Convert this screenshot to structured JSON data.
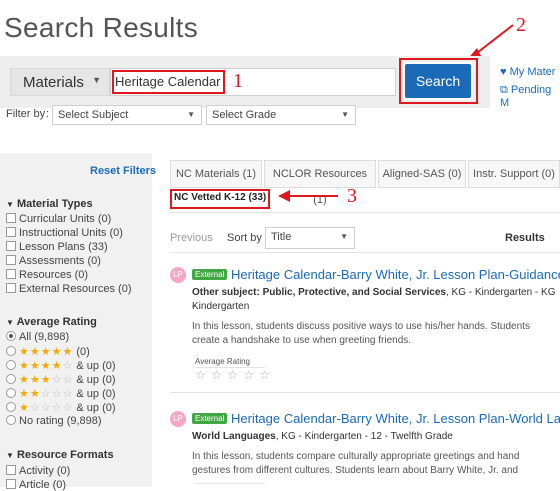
{
  "page": {
    "title": "Search Results"
  },
  "search": {
    "material_type": "Materials",
    "query": "Heritage Calendar",
    "button": "Search"
  },
  "right_links": [
    {
      "icon": "heart-icon",
      "label": "My Mater"
    },
    {
      "icon": "external-link-icon",
      "label": "Pending M"
    }
  ],
  "filter_bar": {
    "label": "Filter by",
    "subject_placeholder": "Select Subject",
    "grade_placeholder": "Select Grade"
  },
  "annotations": [
    "1",
    "2",
    "3"
  ],
  "sidebar": {
    "reset": "Reset Filters",
    "material_types": {
      "heading": "Material Types",
      "items": [
        "Curricular Units  (0)",
        "Instructional Units  (0)",
        "Lesson Plans  (33)",
        "Assessments  (0)",
        "Resources  (0)",
        "External Resources  (0)"
      ]
    },
    "average_rating": {
      "heading": "Average Rating",
      "all": "All  (9,898)",
      "rows": [
        {
          "stars": 5,
          "label": "(0)"
        },
        {
          "stars": 4,
          "label": "& up  (0)"
        },
        {
          "stars": 3,
          "label": "& up  (0)"
        },
        {
          "stars": 2,
          "label": "& up  (0)"
        },
        {
          "stars": 1,
          "label": "& up  (0)"
        }
      ],
      "no_rating": "No rating  (9,898)"
    },
    "resource_formats": {
      "heading": "Resource Formats",
      "items": [
        "Activity  (0)",
        "Article  (0)"
      ]
    }
  },
  "tabs": [
    "NC Materials (1)",
    "NCLOR Resources (1)",
    "Aligned-SAS (0)",
    "Instr. Support (0)"
  ],
  "sub_tab": "NC Vetted K-12 (33)",
  "sort": {
    "previous": "Previous",
    "label": "Sort by",
    "value": "Title",
    "results": "Results"
  },
  "results": [
    {
      "avatar": "LP",
      "badge": "External",
      "title": "Heritage Calendar-Barry White, Jr. Lesson Plan-Guidance ...",
      "subject_bold": "Other subject: Public, Protective, and Social Services",
      "subject_rest": ", KG - Kindergarten - KG -",
      "subject_line2": "Kindergarten",
      "desc1": "In this lesson, students discuss positive ways to use his/her hands. Students",
      "desc2": "create a handshake to use when greeting friends.",
      "rating_label": "Average Rating",
      "rating_stars": "☆ ☆ ☆ ☆ ☆"
    },
    {
      "avatar": "LP",
      "badge": "External",
      "title": "Heritage Calendar-Barry White, Jr. Lesson Plan-World Lan...",
      "subject_bold": "World Languages",
      "subject_rest": ", KG - Kindergarten - 12 - Twelfth Grade",
      "desc1": "In this lesson, students compare culturally appropriate greetings and hand",
      "desc2": "gestures from different cultures. Students learn about Barry White, Jr. and"
    }
  ],
  "colors": {
    "accent": "#1a6ab8",
    "annotation": "#e0171e",
    "badge": "#40a742",
    "star": "#f3a900"
  }
}
